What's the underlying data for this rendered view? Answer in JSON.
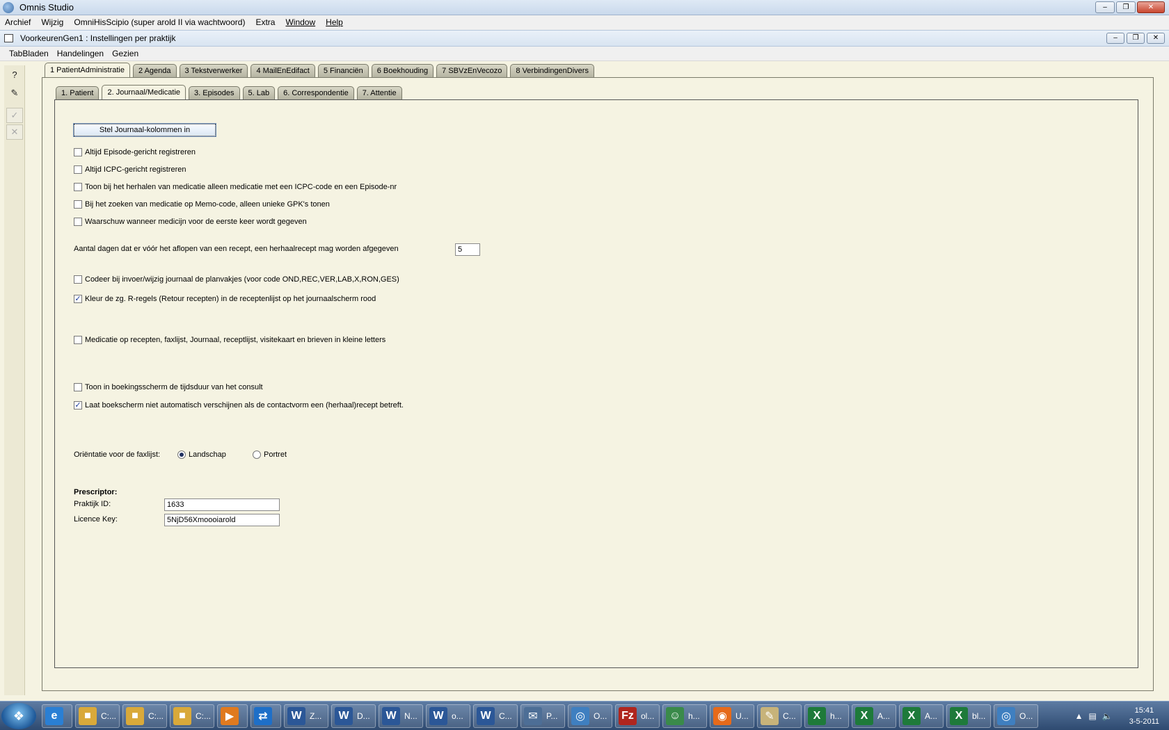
{
  "app": {
    "title": "Omnis Studio",
    "menu": [
      "Archief",
      "Wijzig",
      "OmniHisScipio (super arold II via wachtwoord)",
      "Extra",
      "Window",
      "Help"
    ]
  },
  "child_window": {
    "title": "VoorkeurenGen1 : Instellingen per praktijk",
    "menu": [
      "TabBladen",
      "Handelingen",
      "Gezien"
    ]
  },
  "toolbar": {
    "help_icon": "?",
    "edit_icon": "✎",
    "ok_icon": "✓",
    "cancel_icon": "✕"
  },
  "outer_tabs": [
    {
      "label": "1 PatientAdministratie",
      "active": true
    },
    {
      "label": "2 Agenda",
      "active": false
    },
    {
      "label": "3 Tekstverwerker",
      "active": false
    },
    {
      "label": "4 MailEnEdifact",
      "active": false
    },
    {
      "label": "5 Financiën",
      "active": false
    },
    {
      "label": "6 Boekhouding",
      "active": false
    },
    {
      "label": "7 SBVzEnVecozo",
      "active": false
    },
    {
      "label": "8 VerbindingenDivers",
      "active": false
    }
  ],
  "inner_tabs": [
    {
      "label": "1. Patient",
      "active": false
    },
    {
      "label": "2. Journaal/Medicatie",
      "active": true
    },
    {
      "label": "3. Episodes",
      "active": false
    },
    {
      "label": "5. Lab",
      "active": false
    },
    {
      "label": "6. Correspondentie",
      "active": false
    },
    {
      "label": "7. Attentie",
      "active": false
    }
  ],
  "form": {
    "config_button": "Stel Journaal-kolommen in",
    "checkboxes": [
      {
        "label": "Altijd Episode-gericht registreren",
        "checked": false
      },
      {
        "label": "Altijd ICPC-gericht registreren",
        "checked": false
      },
      {
        "label": "Toon bij het herhalen van medicatie alleen medicatie met een ICPC-code en een Episode-nr",
        "checked": false
      },
      {
        "label": "Bij het zoeken van medicatie op Memo-code, alleen unieke GPK's tonen",
        "checked": false
      },
      {
        "label": "Waarschuw wanneer medicijn voor de eerste keer wordt gegeven",
        "checked": false
      },
      {
        "label": "Codeer bij invoer/wijzig journaal de planvakjes (voor code OND,REC,VER,LAB,X,RON,GES)",
        "checked": false
      },
      {
        "label": "Kleur de zg. R-regels (Retour recepten) in de receptenlijst op het journaalscherm rood",
        "checked": true
      },
      {
        "label": "Medicatie op recepten, faxlijst, Journaal, receptlijst, visitekaart en brieven in kleine letters",
        "checked": false
      },
      {
        "label": "Toon in boekingsscherm de tijdsduur van het consult",
        "checked": false
      },
      {
        "label": "Laat boekscherm niet automatisch verschijnen als de contactvorm een (herhaal)recept betreft.",
        "checked": true
      }
    ],
    "days_label": "Aantal dagen dat er vóór het aflopen van een recept, een herhaalrecept mag worden afgegeven",
    "days_value": "5",
    "orientation_label": "Oriëntatie voor de faxlijst:",
    "orientation_options": [
      {
        "label": "Landschap",
        "selected": true
      },
      {
        "label": "Portret",
        "selected": false
      }
    ],
    "prescriptor_heading": "Prescriptor:",
    "praktijk_id_label": "Praktijk ID:",
    "praktijk_id_value": "1633",
    "licence_key_label": "Licence Key:",
    "licence_key_value": "5NjD56Xmoooiarold"
  },
  "taskbar": {
    "items": [
      {
        "icon": "ie-icon",
        "label": ""
      },
      {
        "icon": "folder-icon",
        "label": "C:..."
      },
      {
        "icon": "folder-icon",
        "label": "C:..."
      },
      {
        "icon": "folder-icon",
        "label": "C:..."
      },
      {
        "icon": "media-player-icon",
        "label": ""
      },
      {
        "icon": "teamviewer-icon",
        "label": ""
      },
      {
        "icon": "word-icon",
        "label": "Z..."
      },
      {
        "icon": "word-icon",
        "label": "D..."
      },
      {
        "icon": "word-icon",
        "label": "N..."
      },
      {
        "icon": "word-icon",
        "label": "o..."
      },
      {
        "icon": "word-icon",
        "label": "C..."
      },
      {
        "icon": "mail-icon",
        "label": "P..."
      },
      {
        "icon": "omnis-icon",
        "label": "O..."
      },
      {
        "icon": "filezilla-icon",
        "label": "ol..."
      },
      {
        "icon": "users-icon",
        "label": "h..."
      },
      {
        "icon": "firefox-icon",
        "label": "U..."
      },
      {
        "icon": "notepad-icon",
        "label": "C..."
      },
      {
        "icon": "excel-icon",
        "label": "h..."
      },
      {
        "icon": "excel-icon",
        "label": "A..."
      },
      {
        "icon": "excel-icon",
        "label": "A..."
      },
      {
        "icon": "excel-icon",
        "label": "bl..."
      },
      {
        "icon": "omnis-icon",
        "label": "O..."
      }
    ],
    "time": "15:41",
    "date": "3-5-2011"
  }
}
